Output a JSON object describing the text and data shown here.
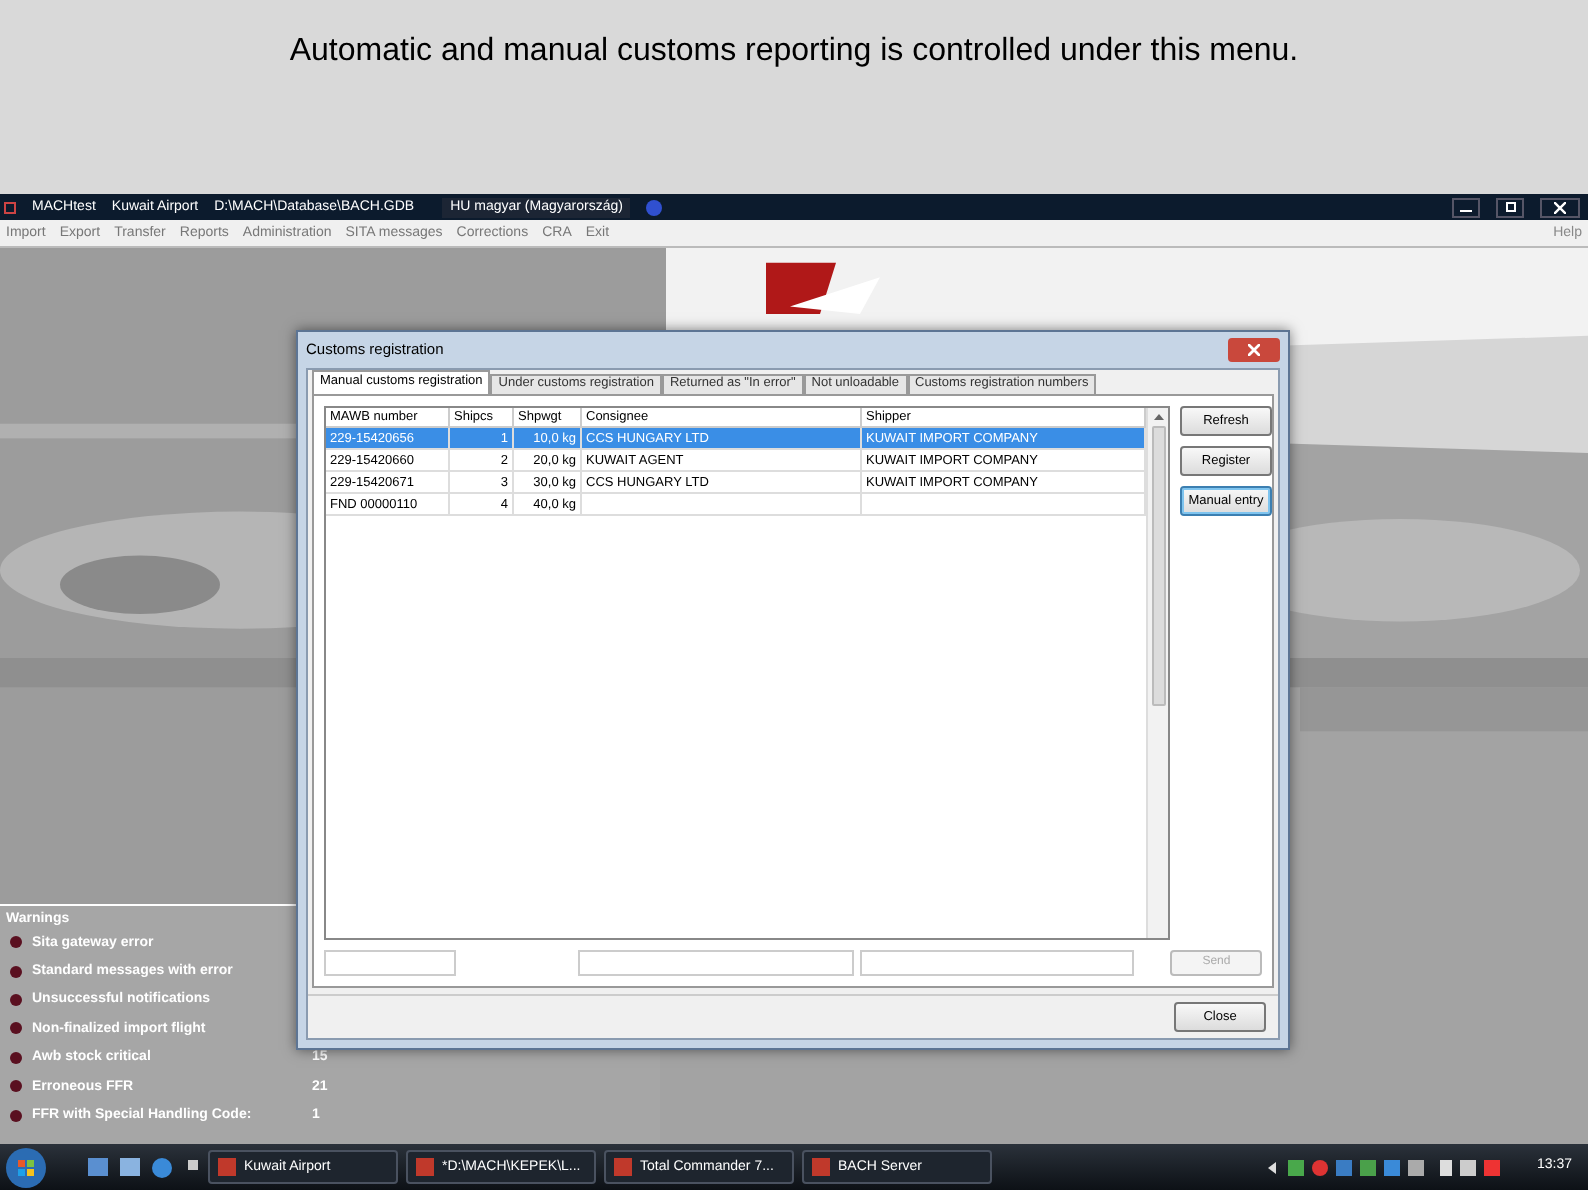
{
  "caption": "Automatic and manual customs reporting is controlled under this menu.",
  "app": {
    "title_parts": [
      "MACHtest",
      "Kuwait Airport",
      "D:\\MACH\\Database\\BACH.GDB"
    ],
    "language": "HU magyar (Magyarország)",
    "menu": [
      "Import",
      "Export",
      "Transfer",
      "Reports",
      "Administration",
      "SITA messages",
      "Corrections",
      "CRA",
      "Exit"
    ],
    "help": "Help"
  },
  "warnings": {
    "title": "Warnings",
    "items": [
      {
        "label": "Sita gateway error"
      },
      {
        "label": "Standard messages with error"
      },
      {
        "label": "Unsuccessful notifications"
      },
      {
        "label": "Non-finalized import flight"
      },
      {
        "label": "Awb stock critical",
        "count": "15"
      },
      {
        "label": "Erroneous FFR",
        "count": "21"
      },
      {
        "label": "FFR with Special Handling Code:",
        "count": "1"
      }
    ]
  },
  "dialog": {
    "title": "Customs registration",
    "tabs": [
      {
        "label": "Manual customs registration",
        "selected": true
      },
      {
        "label": "Under customs registration",
        "selected": false
      },
      {
        "label": "Returned as \"In error\"",
        "selected": false
      },
      {
        "label": "Not unloadable",
        "selected": false
      },
      {
        "label": "Customs registration numbers",
        "selected": false
      }
    ],
    "columns": [
      "MAWB number",
      "Shipcs",
      "Shpwgt",
      "Consignee",
      "Shipper"
    ],
    "rows": [
      {
        "cells": [
          "229-15420656",
          "1",
          "10,0 kg",
          "CCS HUNGARY LTD",
          "KUWAIT IMPORT COMPANY"
        ],
        "selected": true
      },
      {
        "cells": [
          "229-15420660",
          "2",
          "20,0 kg",
          "KUWAIT AGENT",
          "KUWAIT IMPORT COMPANY"
        ],
        "selected": false
      },
      {
        "cells": [
          "229-15420671",
          "3",
          "30,0 kg",
          "CCS HUNGARY LTD",
          "KUWAIT IMPORT COMPANY"
        ],
        "selected": false
      },
      {
        "cells": [
          "FND 00000110",
          "4",
          "40,0 kg",
          "",
          ""
        ],
        "selected": false
      }
    ],
    "side_buttons": [
      {
        "label": "Refresh",
        "focused": false
      },
      {
        "label": "Register",
        "focused": false
      },
      {
        "label": "Manual entry",
        "focused": true
      }
    ],
    "send_button": {
      "label": "Send",
      "disabled": true
    },
    "close_button": "Close"
  },
  "taskbar": {
    "tasks": [
      "Kuwait Airport",
      "*D:\\MACH\\KEPEK\\L...",
      "Total Commander 7...",
      "BACH Server"
    ],
    "clock": "13:37"
  }
}
